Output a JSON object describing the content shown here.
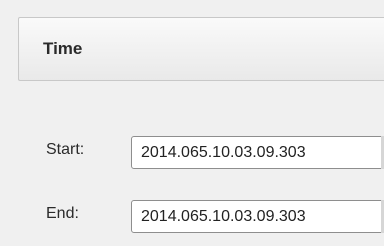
{
  "time_section": {
    "title": "Time"
  },
  "fields": {
    "start": {
      "label": "Start:",
      "value": "2014.065.10.03.09.303"
    },
    "end": {
      "label": "End:",
      "value": "2014.065.10.03.09.303"
    }
  }
}
